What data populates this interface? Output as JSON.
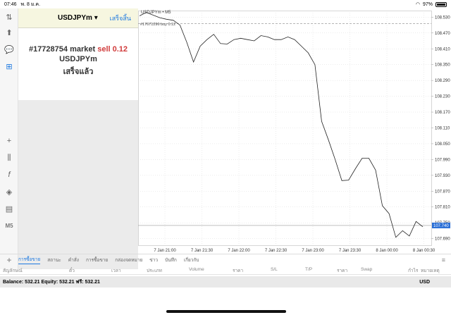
{
  "status": {
    "time": "07:46",
    "date": "พ. 8 ม.ค.",
    "battery": "97%",
    "battery_level": 0.97
  },
  "order": {
    "symbol": "USDJPYm",
    "done_label": "เสร็จสิ้น",
    "line_prefix": "#17728754 market",
    "line_side": "sell 0.12",
    "line_symbol": "USDJPYm",
    "line_status": "เสร็จแล้ว"
  },
  "chart": {
    "title": "USDJPYm • M5",
    "buy_label": "#17671296 buy 0.12",
    "current_price": "107.740"
  },
  "chart_data": {
    "type": "line",
    "x_labels": [
      "7 Jan 21:00",
      "7 Jan 21:30",
      "7 Jan 22:00",
      "7 Jan 22:30",
      "7 Jan 23:00",
      "7 Jan 23:30",
      "8 Jan 00:00",
      "8 Jan 00:30"
    ],
    "y_labels": [
      "108.530",
      "108.470",
      "108.410",
      "108.350",
      "108.290",
      "108.230",
      "108.170",
      "108.110",
      "108.050",
      "107.990",
      "107.930",
      "107.870",
      "107.810",
      "107.750",
      "107.690"
    ],
    "ylim": [
      107.665,
      108.555
    ],
    "buy_price": 108.505,
    "current_price": 107.74,
    "values": [
      108.535,
      108.548,
      108.538,
      108.528,
      108.522,
      108.518,
      108.5,
      108.435,
      108.36,
      108.42,
      108.445,
      108.465,
      108.43,
      108.428,
      108.445,
      108.45,
      108.445,
      108.44,
      108.46,
      108.455,
      108.445,
      108.445,
      108.455,
      108.445,
      108.42,
      108.395,
      108.35,
      108.135,
      108.065,
      107.99,
      107.91,
      107.912,
      107.955,
      107.995,
      107.995,
      107.95,
      107.815,
      107.785,
      107.695,
      107.72,
      107.7,
      107.755,
      107.735
    ]
  },
  "tabs": [
    "การซื้อขาย",
    "สถานะ",
    "คำสั่ง",
    "การซื้อขาย",
    "กล่องจดหมาย",
    "ข่าว",
    "บันทึก",
    "เกี่ยวกับ"
  ],
  "columns": [
    "สัญลักษณ์",
    "ตั๋ว",
    "เวลา",
    "ประเภท",
    "Volume",
    "ราคา",
    "S/L",
    "T/P",
    "ราคา",
    "Swap",
    "กำไร",
    "หมายเหตุ"
  ],
  "balance": {
    "text": "Balance: 532.21  Equity: 532.21  ฟรี: 532.21",
    "currency": "USD"
  },
  "left_tools": [
    "M5"
  ]
}
